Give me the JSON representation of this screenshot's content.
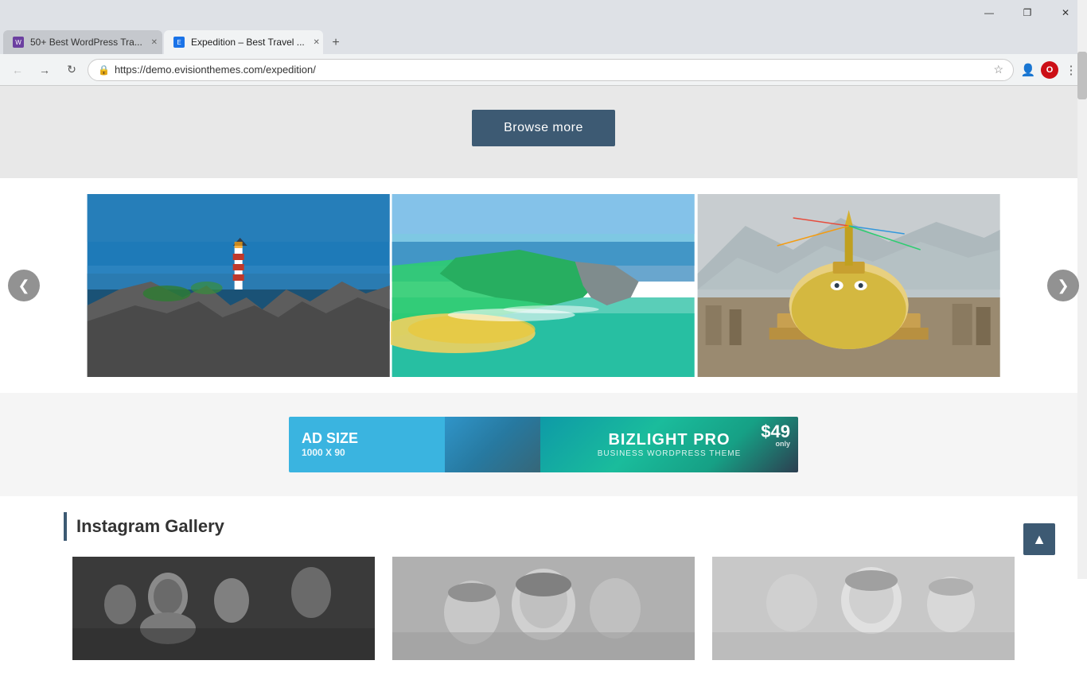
{
  "browser": {
    "tabs": [
      {
        "id": "tab1",
        "label": "50+ Best WordPress Tra...",
        "favicon_color": "purple",
        "favicon_text": "W",
        "active": false
      },
      {
        "id": "tab2",
        "label": "Expedition – Best Travel ...",
        "favicon_color": "blue",
        "favicon_text": "E",
        "active": true
      }
    ],
    "address": "https://demo.evisionthemes.com/expedition/",
    "secure_label": "Secure"
  },
  "toolbar": {
    "browse_more_label": "Browse more"
  },
  "slider": {
    "prev_arrow": "❮",
    "next_arrow": "❯",
    "images": [
      {
        "alt": "Lighthouse on rocky coast with blue ocean"
      },
      {
        "alt": "Cape Point coastal aerial view"
      },
      {
        "alt": "Boudhanath Stupa in Kathmandu"
      }
    ]
  },
  "ads": {
    "left": {
      "title": "AD SIZE",
      "subtitle": "1000 X 90"
    },
    "right": {
      "title": "BIZLIGHT PRO",
      "subtitle": "BUSINESS WORDPRESS THEME",
      "price": "$49",
      "price_only": "only"
    }
  },
  "instagram": {
    "section_title": "Instagram Gallery",
    "images": [
      {
        "alt": "Black and white portrait 1"
      },
      {
        "alt": "Black and white portrait 2"
      },
      {
        "alt": "Black and white portrait 3"
      }
    ]
  },
  "scroll_top": "▲",
  "window_controls": {
    "minimize": "—",
    "maximize": "❐",
    "close": "✕"
  }
}
